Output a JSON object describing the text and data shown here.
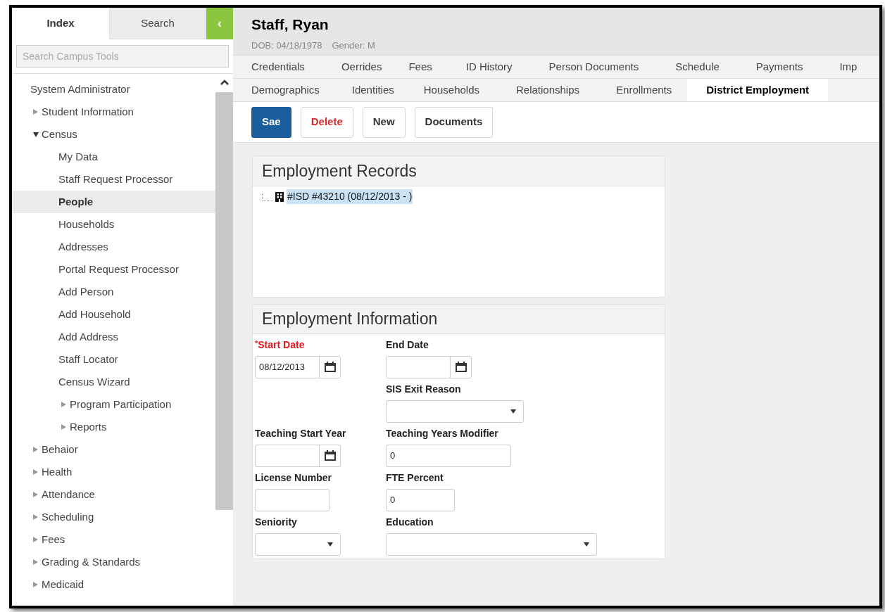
{
  "sidebar": {
    "tabs": [
      {
        "label": "Index",
        "selected": true
      },
      {
        "label": "Search",
        "selected": false
      }
    ],
    "toggle": "‹",
    "search": {
      "placeholder": "Search Campus Tools"
    },
    "tree": [
      {
        "label": "System Administrator",
        "selected": false,
        "children": [
          {
            "label": "Student Information",
            "selected": false,
            "expanded": false
          },
          {
            "label": "Census",
            "selected": false,
            "expanded": true,
            "children": [
              {
                "label": "My Data",
                "selected": false
              },
              {
                "label": "Staff Request Processor",
                "selected": false
              },
              {
                "label": "People",
                "selected": true
              },
              {
                "label": "Households",
                "selected": false
              },
              {
                "label": "Addresses",
                "selected": false
              },
              {
                "label": "Portal Request Processor",
                "selected": false
              },
              {
                "label": "Add Person",
                "selected": false
              },
              {
                "label": "Add Household",
                "selected": false
              },
              {
                "label": "Add Address",
                "selected": false
              },
              {
                "label": "Staff Locator",
                "selected": false
              },
              {
                "label": "Census Wizard",
                "selected": false
              },
              {
                "label": "Program Participation",
                "selected": false,
                "expanded": false
              },
              {
                "label": "Reports",
                "selected": false,
                "expanded": false
              }
            ]
          },
          {
            "label": "Behaior",
            "selected": false,
            "expanded": false
          },
          {
            "label": "Health",
            "selected": false,
            "expanded": false
          },
          {
            "label": "Attendance",
            "selected": false,
            "expanded": false
          },
          {
            "label": "Scheduling",
            "selected": false,
            "expanded": false
          },
          {
            "label": "Fees",
            "selected": false,
            "expanded": false
          },
          {
            "label": "Grading & Standards",
            "selected": false,
            "expanded": false
          },
          {
            "label": "Medicaid",
            "selected": false,
            "expanded": false
          }
        ]
      }
    ]
  },
  "person": {
    "name": "Staff, Ryan",
    "dob": "DOB: 04/18/1978",
    "gender": "Gender: M"
  },
  "tab_rows": [
    [
      {
        "label": "Credentials",
        "selected": false
      },
      {
        "label": "Oerrides",
        "selected": false
      },
      {
        "label": "Fees",
        "selected": false
      },
      {
        "label": "ID History",
        "selected": false
      },
      {
        "label": "Person Documents",
        "selected": false
      },
      {
        "label": "Schedule",
        "selected": false
      },
      {
        "label": "Payments",
        "selected": false
      },
      {
        "label": "Imp",
        "selected": false
      }
    ],
    [
      {
        "label": "Demographics",
        "selected": false
      },
      {
        "label": "Identities",
        "selected": false
      },
      {
        "label": "Households",
        "selected": false
      },
      {
        "label": "Relationships",
        "selected": false
      },
      {
        "label": "Enrollments",
        "selected": false
      },
      {
        "label": "District Employment",
        "selected": true
      }
    ]
  ],
  "toolbar": [
    {
      "label": "Sae",
      "kind": "primary"
    },
    {
      "label": "Delete",
      "kind": "danger"
    },
    {
      "label": "New",
      "kind": "default"
    },
    {
      "label": "Documents",
      "kind": "default"
    }
  ],
  "records": {
    "title": "Employment Records",
    "items": [
      {
        "label": "#ISD #43210 (08/12/2013 - )",
        "selected": true
      }
    ]
  },
  "info": {
    "title": "Employment Information",
    "required_mark": "*",
    "rows": [
      [
        {
          "label": "Start Date",
          "kind": "date",
          "value": "08/12/2013",
          "required": true
        },
        {
          "label": "End Date",
          "kind": "date",
          "required": false
        }
      ],
      [
        null,
        {
          "label": "SIS Exit Reason",
          "kind": "select",
          "required": false
        }
      ],
      [
        {
          "label": "Teaching Start Year",
          "kind": "date",
          "required": false
        },
        {
          "label": "Teaching Years Modifier",
          "kind": "text",
          "value": "0",
          "required": false
        }
      ],
      [
        {
          "label": "License Number",
          "kind": "text",
          "required": false
        },
        {
          "label": "FTE Percent",
          "kind": "text",
          "value": "0",
          "required": false
        }
      ],
      [
        {
          "label": "Seniority",
          "kind": "select",
          "required": false
        },
        {
          "label": "Education",
          "kind": "select",
          "required": false
        }
      ]
    ]
  }
}
